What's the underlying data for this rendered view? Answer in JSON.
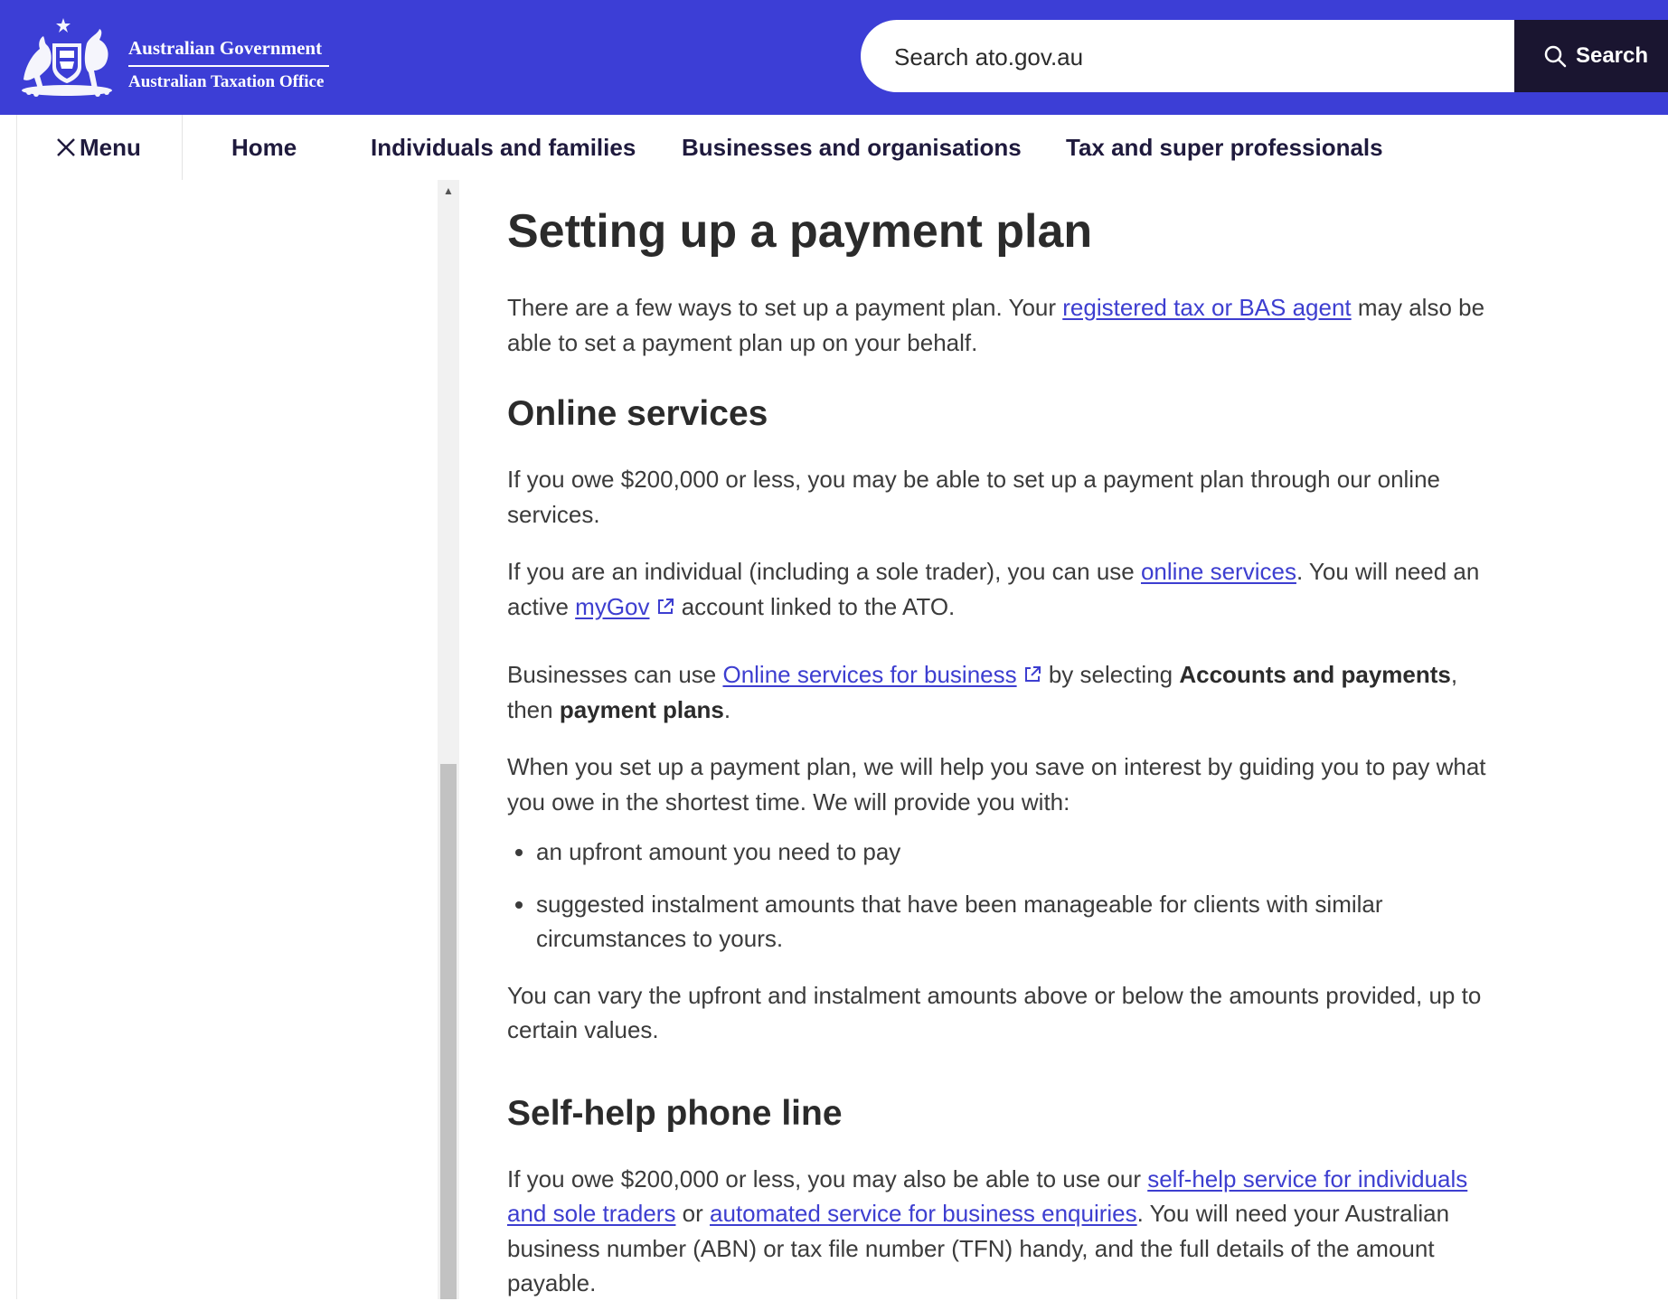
{
  "header": {
    "logo_line1": "Australian Government",
    "logo_line2": "Australian Taxation Office",
    "search_placeholder": "Search ato.gov.au",
    "search_button": "Search"
  },
  "nav": {
    "menu_label": "Menu",
    "items": [
      "Home",
      "Individuals and families",
      "Businesses and organisations",
      "Tax and super professionals"
    ]
  },
  "article": {
    "title": "Setting up a payment plan",
    "intro": {
      "before": "There are a few ways to set up a payment plan. Your ",
      "link": "registered tax or BAS agent",
      "after": " may also be able to set a payment plan up on your behalf."
    },
    "online_services": {
      "heading": "Online services",
      "p1": "If you owe $200,000 or less, you may be able to set up a payment plan through our online services.",
      "p2_before": "If you are an individual (including a sole trader), you can use ",
      "p2_link": "online services",
      "p2_middle": ". You will need an active ",
      "p2_link2": "myGov",
      "p2_after": " account linked to the ATO.",
      "p3_before": "Businesses can use ",
      "p3_link": "Online services for business",
      "p3_middle": " by selecting ",
      "p3_bold1": "Accounts and payments",
      "p3_middle2": ", then ",
      "p3_bold2": "payment plans",
      "p3_after": ".",
      "p4": "When you set up a payment plan, we will help you save on interest by guiding you to pay what you owe in the shortest time. We will provide you with:",
      "bullets": [
        "an upfront amount you need to pay",
        "suggested instalment amounts that have been manageable for clients with similar circumstances to yours."
      ],
      "p5": "You can vary the upfront and instalment amounts above or below the amounts provided, up to certain values."
    },
    "self_help": {
      "heading": "Self-help phone line",
      "before": "If you owe $200,000 or less, you may also be able to use our ",
      "link1": "self-help service for individuals and sole traders",
      "middle": " or ",
      "link2": "automated service for business enquiries",
      "after": ". You will need your Australian business number (ABN) or tax file number (TFN) handy, and the full details of the amount payable."
    }
  },
  "colors": {
    "header_bg": "#3c3ed6",
    "search_button_bg": "#1a1530",
    "link": "#3d3ed0"
  }
}
